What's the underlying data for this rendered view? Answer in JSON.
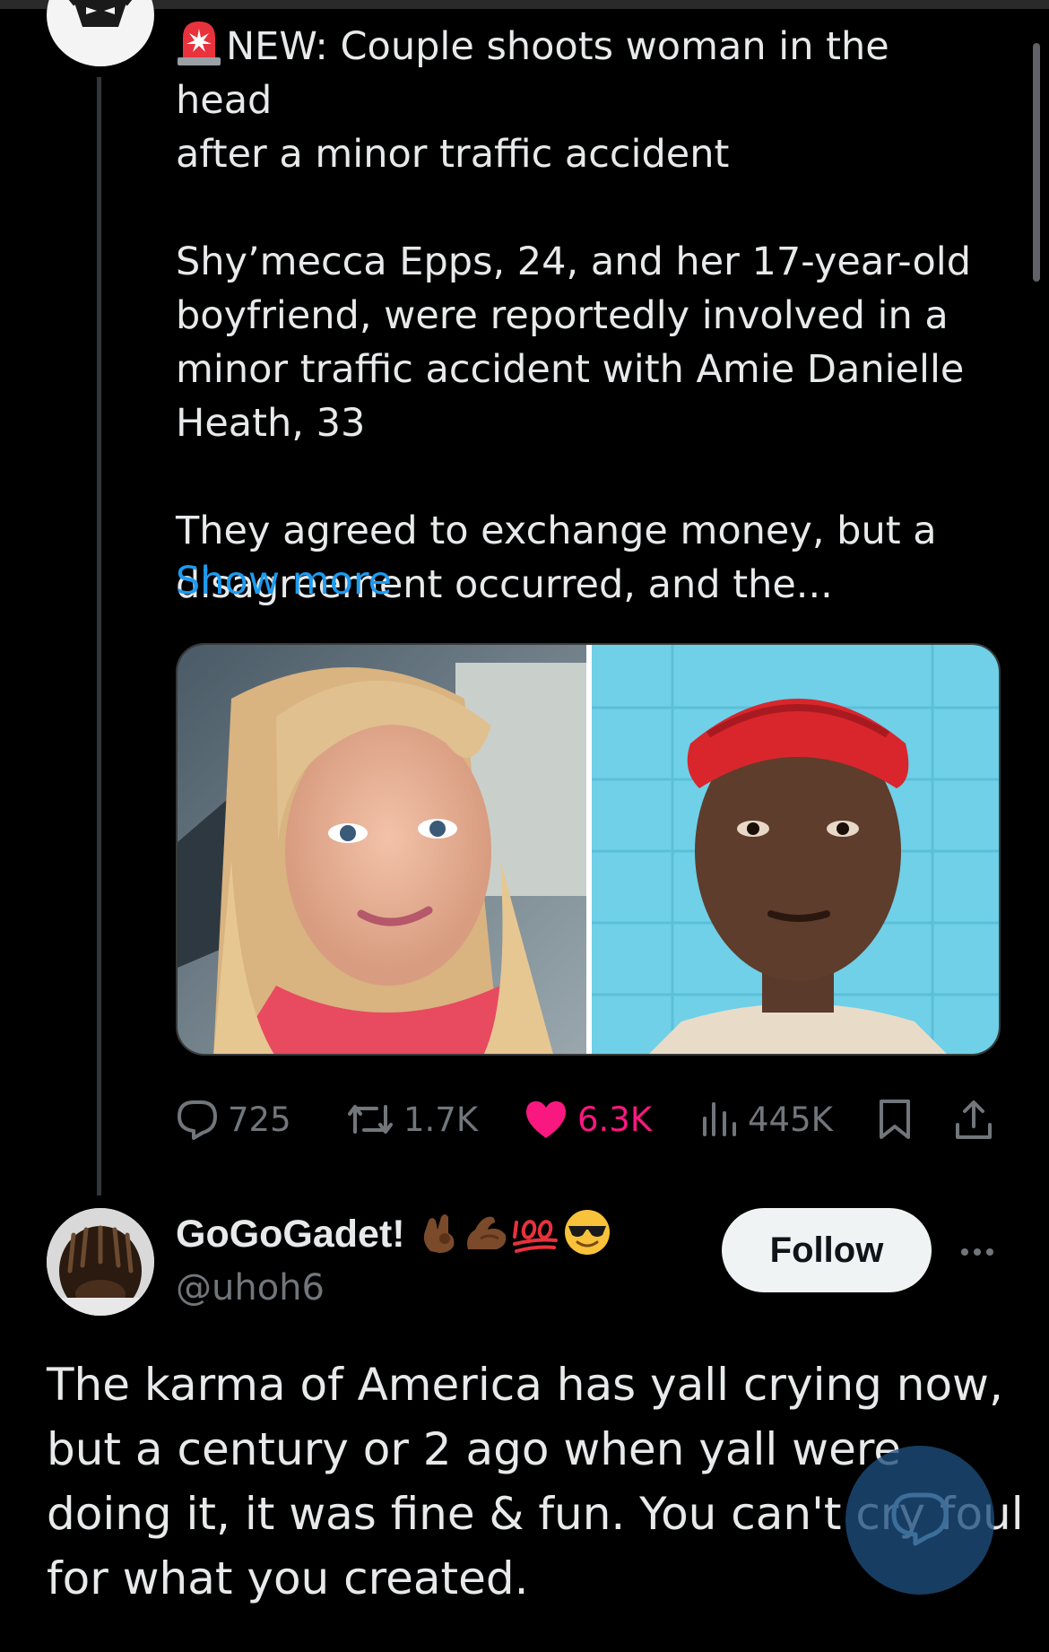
{
  "tweet": {
    "text": "NEW: Couple shoots woman in the head\nafter a minor traffic accident\n\nShy’mecca Epps, 24, and her 17-year-old\nboyfriend, were reportedly involved in a\nminor traffic accident with Amie Danielle\nHeath, 33\n\nThey agreed to exchange money, but a\ndisagreement occurred, and the...",
    "show_more": "Show more",
    "actions": {
      "replies": "725",
      "reposts": "1.7K",
      "likes": "6.3K",
      "views": "445K"
    },
    "like_color": "#f91880",
    "link_color": "#1d9bf0"
  },
  "reply": {
    "display_name": "GoGoGadet!",
    "handle": "@uhoh6",
    "follow_label": "Follow",
    "text": "The karma of America has yall crying now, but a century or 2 ago when yall were doing it, it was fine & fun. You can't cry foul for what you created.",
    "name_emojis": [
      "ok-hand-dark-skin-icon",
      "flexed-biceps-dark-skin-icon",
      "hundred-points-icon",
      "smiling-face-sunglasses-icon"
    ]
  },
  "icons": {
    "siren": "police-light-icon",
    "reply": "reply-icon",
    "repost": "repost-icon",
    "like": "heart-icon",
    "views": "views-chart-icon",
    "bookmark": "bookmark-icon",
    "share": "share-icon",
    "more": "more-dots-icon",
    "fab": "compose-reply-icon"
  }
}
